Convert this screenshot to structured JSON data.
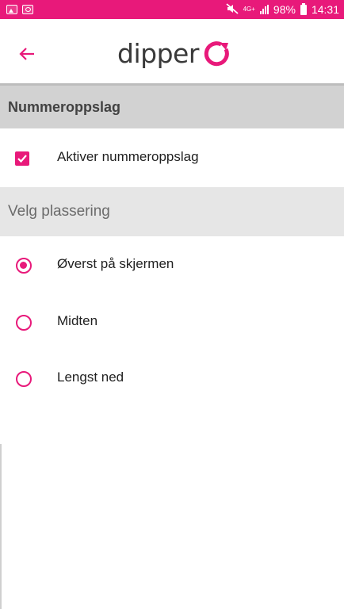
{
  "status_bar": {
    "left_icons": [
      "image-notification-icon",
      "chat-notification-icon"
    ],
    "network_type": "4G+",
    "battery": "98%",
    "time": "14:31"
  },
  "app_bar": {
    "back_icon": "arrow-left-icon",
    "logo_text": "dipper"
  },
  "section": {
    "title": "Nummeroppslag"
  },
  "toggle": {
    "label": "Aktiver nummeroppslag",
    "checked": true
  },
  "placement": {
    "title": "Velg plassering",
    "options": [
      {
        "label": "Øverst på skjermen",
        "selected": true
      },
      {
        "label": "Midten",
        "selected": false
      },
      {
        "label": "Lengst ned",
        "selected": false
      }
    ]
  },
  "colors": {
    "accent": "#e8197a",
    "section_bg": "#d2d2d2",
    "subsection_bg": "#e6e6e6"
  }
}
